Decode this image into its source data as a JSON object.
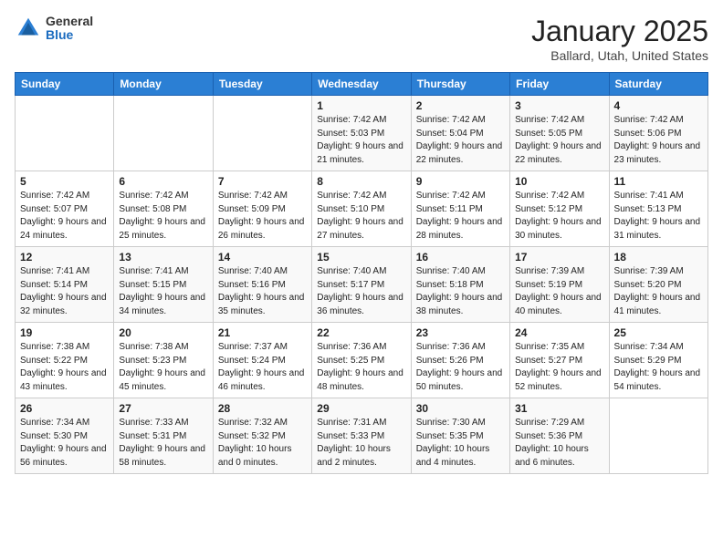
{
  "header": {
    "logo_general": "General",
    "logo_blue": "Blue",
    "month_year": "January 2025",
    "location": "Ballard, Utah, United States"
  },
  "weekdays": [
    "Sunday",
    "Monday",
    "Tuesday",
    "Wednesday",
    "Thursday",
    "Friday",
    "Saturday"
  ],
  "weeks": [
    [
      {
        "day": "",
        "sunrise": "",
        "sunset": "",
        "daylight": ""
      },
      {
        "day": "",
        "sunrise": "",
        "sunset": "",
        "daylight": ""
      },
      {
        "day": "",
        "sunrise": "",
        "sunset": "",
        "daylight": ""
      },
      {
        "day": "1",
        "sunrise": "Sunrise: 7:42 AM",
        "sunset": "Sunset: 5:03 PM",
        "daylight": "Daylight: 9 hours and 21 minutes."
      },
      {
        "day": "2",
        "sunrise": "Sunrise: 7:42 AM",
        "sunset": "Sunset: 5:04 PM",
        "daylight": "Daylight: 9 hours and 22 minutes."
      },
      {
        "day": "3",
        "sunrise": "Sunrise: 7:42 AM",
        "sunset": "Sunset: 5:05 PM",
        "daylight": "Daylight: 9 hours and 22 minutes."
      },
      {
        "day": "4",
        "sunrise": "Sunrise: 7:42 AM",
        "sunset": "Sunset: 5:06 PM",
        "daylight": "Daylight: 9 hours and 23 minutes."
      }
    ],
    [
      {
        "day": "5",
        "sunrise": "Sunrise: 7:42 AM",
        "sunset": "Sunset: 5:07 PM",
        "daylight": "Daylight: 9 hours and 24 minutes."
      },
      {
        "day": "6",
        "sunrise": "Sunrise: 7:42 AM",
        "sunset": "Sunset: 5:08 PM",
        "daylight": "Daylight: 9 hours and 25 minutes."
      },
      {
        "day": "7",
        "sunrise": "Sunrise: 7:42 AM",
        "sunset": "Sunset: 5:09 PM",
        "daylight": "Daylight: 9 hours and 26 minutes."
      },
      {
        "day": "8",
        "sunrise": "Sunrise: 7:42 AM",
        "sunset": "Sunset: 5:10 PM",
        "daylight": "Daylight: 9 hours and 27 minutes."
      },
      {
        "day": "9",
        "sunrise": "Sunrise: 7:42 AM",
        "sunset": "Sunset: 5:11 PM",
        "daylight": "Daylight: 9 hours and 28 minutes."
      },
      {
        "day": "10",
        "sunrise": "Sunrise: 7:42 AM",
        "sunset": "Sunset: 5:12 PM",
        "daylight": "Daylight: 9 hours and 30 minutes."
      },
      {
        "day": "11",
        "sunrise": "Sunrise: 7:41 AM",
        "sunset": "Sunset: 5:13 PM",
        "daylight": "Daylight: 9 hours and 31 minutes."
      }
    ],
    [
      {
        "day": "12",
        "sunrise": "Sunrise: 7:41 AM",
        "sunset": "Sunset: 5:14 PM",
        "daylight": "Daylight: 9 hours and 32 minutes."
      },
      {
        "day": "13",
        "sunrise": "Sunrise: 7:41 AM",
        "sunset": "Sunset: 5:15 PM",
        "daylight": "Daylight: 9 hours and 34 minutes."
      },
      {
        "day": "14",
        "sunrise": "Sunrise: 7:40 AM",
        "sunset": "Sunset: 5:16 PM",
        "daylight": "Daylight: 9 hours and 35 minutes."
      },
      {
        "day": "15",
        "sunrise": "Sunrise: 7:40 AM",
        "sunset": "Sunset: 5:17 PM",
        "daylight": "Daylight: 9 hours and 36 minutes."
      },
      {
        "day": "16",
        "sunrise": "Sunrise: 7:40 AM",
        "sunset": "Sunset: 5:18 PM",
        "daylight": "Daylight: 9 hours and 38 minutes."
      },
      {
        "day": "17",
        "sunrise": "Sunrise: 7:39 AM",
        "sunset": "Sunset: 5:19 PM",
        "daylight": "Daylight: 9 hours and 40 minutes."
      },
      {
        "day": "18",
        "sunrise": "Sunrise: 7:39 AM",
        "sunset": "Sunset: 5:20 PM",
        "daylight": "Daylight: 9 hours and 41 minutes."
      }
    ],
    [
      {
        "day": "19",
        "sunrise": "Sunrise: 7:38 AM",
        "sunset": "Sunset: 5:22 PM",
        "daylight": "Daylight: 9 hours and 43 minutes."
      },
      {
        "day": "20",
        "sunrise": "Sunrise: 7:38 AM",
        "sunset": "Sunset: 5:23 PM",
        "daylight": "Daylight: 9 hours and 45 minutes."
      },
      {
        "day": "21",
        "sunrise": "Sunrise: 7:37 AM",
        "sunset": "Sunset: 5:24 PM",
        "daylight": "Daylight: 9 hours and 46 minutes."
      },
      {
        "day": "22",
        "sunrise": "Sunrise: 7:36 AM",
        "sunset": "Sunset: 5:25 PM",
        "daylight": "Daylight: 9 hours and 48 minutes."
      },
      {
        "day": "23",
        "sunrise": "Sunrise: 7:36 AM",
        "sunset": "Sunset: 5:26 PM",
        "daylight": "Daylight: 9 hours and 50 minutes."
      },
      {
        "day": "24",
        "sunrise": "Sunrise: 7:35 AM",
        "sunset": "Sunset: 5:27 PM",
        "daylight": "Daylight: 9 hours and 52 minutes."
      },
      {
        "day": "25",
        "sunrise": "Sunrise: 7:34 AM",
        "sunset": "Sunset: 5:29 PM",
        "daylight": "Daylight: 9 hours and 54 minutes."
      }
    ],
    [
      {
        "day": "26",
        "sunrise": "Sunrise: 7:34 AM",
        "sunset": "Sunset: 5:30 PM",
        "daylight": "Daylight: 9 hours and 56 minutes."
      },
      {
        "day": "27",
        "sunrise": "Sunrise: 7:33 AM",
        "sunset": "Sunset: 5:31 PM",
        "daylight": "Daylight: 9 hours and 58 minutes."
      },
      {
        "day": "28",
        "sunrise": "Sunrise: 7:32 AM",
        "sunset": "Sunset: 5:32 PM",
        "daylight": "Daylight: 10 hours and 0 minutes."
      },
      {
        "day": "29",
        "sunrise": "Sunrise: 7:31 AM",
        "sunset": "Sunset: 5:33 PM",
        "daylight": "Daylight: 10 hours and 2 minutes."
      },
      {
        "day": "30",
        "sunrise": "Sunrise: 7:30 AM",
        "sunset": "Sunset: 5:35 PM",
        "daylight": "Daylight: 10 hours and 4 minutes."
      },
      {
        "day": "31",
        "sunrise": "Sunrise: 7:29 AM",
        "sunset": "Sunset: 5:36 PM",
        "daylight": "Daylight: 10 hours and 6 minutes."
      },
      {
        "day": "",
        "sunrise": "",
        "sunset": "",
        "daylight": ""
      }
    ]
  ]
}
